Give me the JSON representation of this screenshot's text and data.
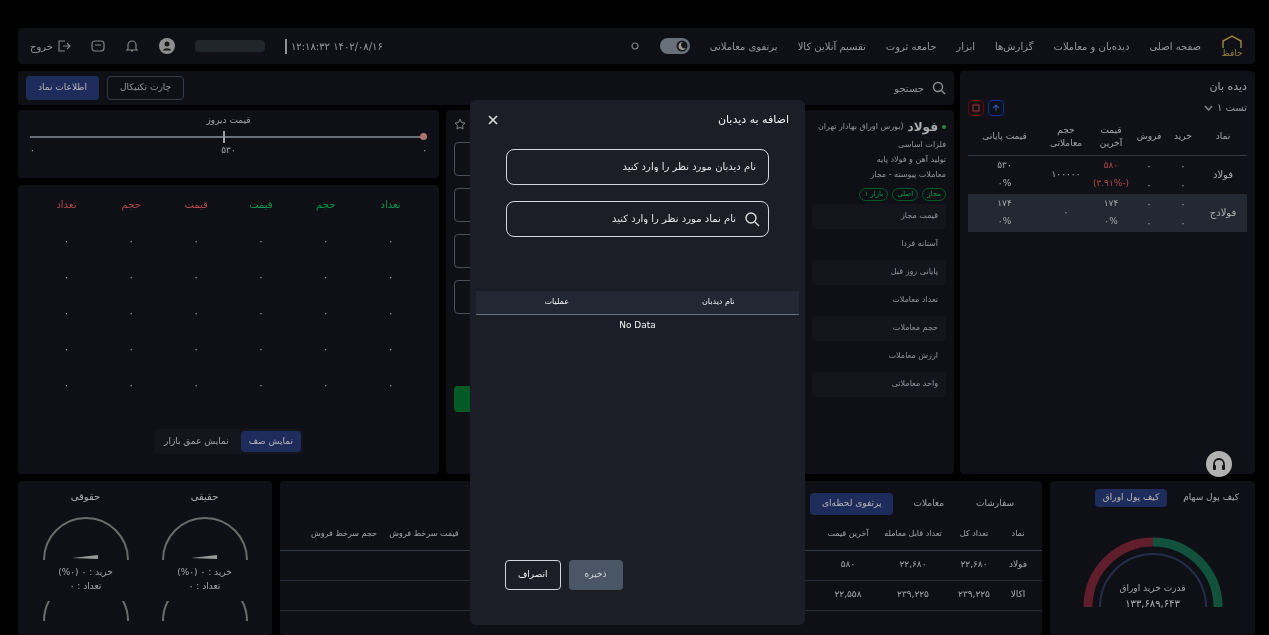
{
  "header": {
    "logo": "حافظ",
    "nav": [
      "صفحه اصلی",
      "دیده‌بان و معاملات",
      "گزارش‌ها",
      "ابزار",
      "جامعه ثروت",
      "تقسیم آنلاین کالا",
      "پرتفوی معاملاتی"
    ],
    "dark_mode": true,
    "datetime": "۱۴۰۲/۰۸/۱۶ ۱۲:۱۸:۳۲",
    "logout": "خروج"
  },
  "toolbar": {
    "search_placeholder": "جستجو",
    "buttons": [
      {
        "label": "چارت تکنیکال",
        "selected": false
      },
      {
        "label": "اطلاعات نماد",
        "selected": true
      }
    ]
  },
  "watchlist": {
    "title": "دیده بان",
    "list_name": "تست ۱",
    "columns": [
      "نماد",
      "خرید",
      "فروش",
      "قیمت آخرین",
      "حجم معاملاتی",
      "قیمت پایانی"
    ],
    "rows": [
      {
        "symbol": "فولاد",
        "buy": [
          "۰",
          "۰"
        ],
        "sell": [
          "۰",
          "۰"
        ],
        "last": [
          "۵۸۰",
          "(-۳.۹۱%)"
        ],
        "last_down": true,
        "volume": "۱۰۰۰۰۰",
        "close": [
          "۵۳۰",
          "۰%"
        ],
        "selected": false
      },
      {
        "symbol": "فولادج",
        "buy": [
          "۰",
          "۰"
        ],
        "sell": [
          "۰",
          "۰"
        ],
        "last": [
          "۱۷۴",
          "۰%"
        ],
        "last_down": false,
        "volume": "۰",
        "close": [
          "۱۷۴",
          "۰%"
        ],
        "selected": true
      }
    ]
  },
  "symbol_info": {
    "name": "فولاد",
    "market": "(بورس اوراق بهادار تهران",
    "lines": [
      "فلزات اساسی",
      "تولید آهن و فولاد پایه",
      "معاملات پیوسته - مجاز"
    ],
    "tags": [
      "مجاز",
      "اصلی",
      "بازار ۱"
    ],
    "fields": [
      "قیمت مجاز",
      "آستانه فردا",
      "پایانی روز قبل",
      "تعداد معاملات",
      "حجم معاملات",
      "ارزش معاملات",
      "واحد معاملاتی"
    ]
  },
  "price_slider": {
    "title": "قیمت دیروز",
    "value": "۵۳۰",
    "min": "۰",
    "max": "۰",
    "level": 0.51
  },
  "order_book": {
    "columns": [
      {
        "label": "تعداد",
        "kind": "buy"
      },
      {
        "label": "حجم",
        "kind": "buy"
      },
      {
        "label": "قیمت",
        "kind": "buy"
      },
      {
        "label": "قیمت",
        "kind": "sell"
      },
      {
        "label": "حجم",
        "kind": "sell"
      },
      {
        "label": "تعداد",
        "kind": "sell"
      }
    ],
    "rows": [
      [
        "۰",
        "۰",
        "۰",
        "۰",
        "۰",
        "۰"
      ],
      [
        "۰",
        "۰",
        "۰",
        "۰",
        "۰",
        "۰"
      ],
      [
        "۰",
        "۰",
        "۰",
        "۰",
        "۰",
        "۰"
      ],
      [
        "۰",
        "۰",
        "۰",
        "۰",
        "۰",
        "۰"
      ],
      [
        "۰",
        "۰",
        "۰",
        "۰",
        "۰",
        "۰"
      ]
    ],
    "views": [
      {
        "label": "نمایش صف",
        "selected": true
      },
      {
        "label": "نمایش عمق بازار",
        "selected": false
      }
    ]
  },
  "gauges": [
    {
      "title": "حقیقی",
      "line1": "خرید : ۰ (۰%)",
      "line2": "تعداد : ۰"
    },
    {
      "title": "حقوقی",
      "line1": "خرید : ۰ (۰%)",
      "line2": "تعداد : ۰"
    }
  ],
  "orders": {
    "tabs": [
      {
        "label": "سفارشات",
        "selected": false
      },
      {
        "label": "معاملات",
        "selected": false
      },
      {
        "label": "پرتفوی لحظه‌ای",
        "selected": true
      }
    ],
    "columns": [
      "نماد",
      "تعداد کل",
      "تعداد قابل معامله",
      "آخرین قیمت"
    ],
    "queue_columns": [
      "قیمت سرخط فروش",
      "حجم سرخط فروش"
    ],
    "rows": [
      [
        "فولاد",
        "۲۲,۶۸۰",
        "۲۲,۶۸۰",
        "۵۸۰"
      ],
      [
        "اکالا",
        "۲۳۹,۲۲۵",
        "۲۳۹,۲۲۵",
        "۲۲,۵۵۸"
      ]
    ]
  },
  "wallet": {
    "tabs": [
      {
        "label": "کیف پول سهام",
        "selected": false
      },
      {
        "label": "کیف پول اوراق",
        "selected": true
      }
    ],
    "caption": "قدرت خرید اوراق",
    "amount": "۱۳۳,۶۸۹,۶۴۳"
  },
  "modal": {
    "title": "اضافه به دیدبان",
    "name_placeholder": "نام دیدبان مورد نظر را وارد کنید",
    "symbol_placeholder": "نام نماد مورد نظر را وارد کنید",
    "columns": [
      "نام دیدبان",
      "عملیات"
    ],
    "empty": "No Data",
    "cancel": "انصراف",
    "save": {
      "label": "ذخیره",
      "disabled": true
    }
  }
}
